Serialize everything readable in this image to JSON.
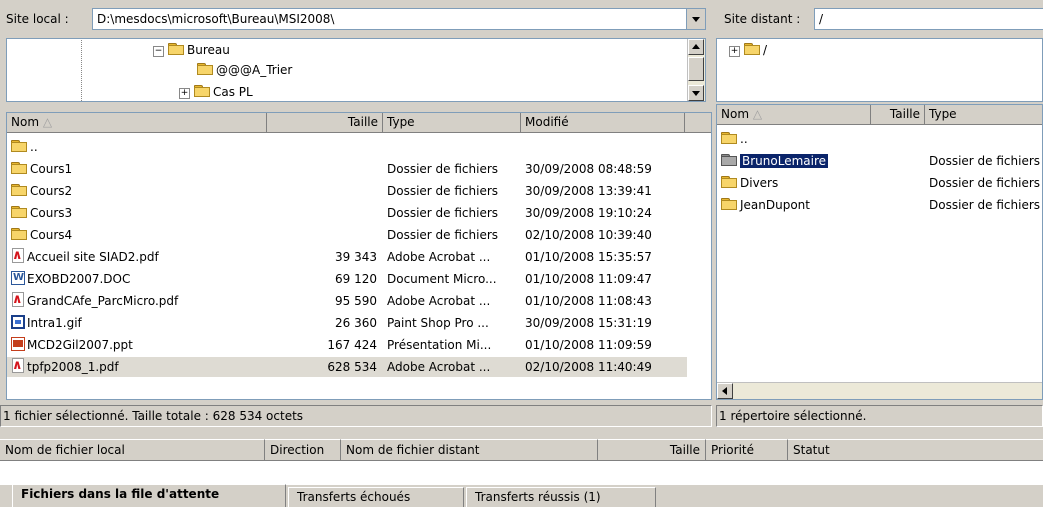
{
  "local": {
    "site_label": "Site local :",
    "path": "D:\\mesdocs\\microsoft\\Bureau\\MSI2008\\",
    "tree": [
      "Bureau",
      "@@@A_Trier",
      "Cas PL"
    ],
    "columns": {
      "name": "Nom",
      "size": "Taille",
      "type": "Type",
      "modified": "Modifié"
    },
    "files": [
      {
        "name": "..",
        "size": "",
        "type": "",
        "modified": "",
        "icon": "folder-icon"
      },
      {
        "name": "Cours1",
        "size": "",
        "type": "Dossier de fichiers",
        "modified": "30/09/2008 08:48:59",
        "icon": "folder-icon"
      },
      {
        "name": "Cours2",
        "size": "",
        "type": "Dossier de fichiers",
        "modified": "30/09/2008 13:39:41",
        "icon": "folder-icon"
      },
      {
        "name": "Cours3",
        "size": "",
        "type": "Dossier de fichiers",
        "modified": "30/09/2008 19:10:24",
        "icon": "folder-icon"
      },
      {
        "name": "Cours4",
        "size": "",
        "type": "Dossier de fichiers",
        "modified": "02/10/2008 10:39:40",
        "icon": "folder-icon"
      },
      {
        "name": "Accueil site SIAD2.pdf",
        "size": "39 343",
        "type": "Adobe Acrobat ...",
        "modified": "01/10/2008 15:35:57",
        "icon": "pdf-icon"
      },
      {
        "name": "EXOBD2007.DOC",
        "size": "69 120",
        "type": "Document Micro...",
        "modified": "01/10/2008 11:09:47",
        "icon": "word-doc-icon"
      },
      {
        "name": "GrandCAfe_ParcMicro.pdf",
        "size": "95 590",
        "type": "Adobe Acrobat ...",
        "modified": "01/10/2008 11:08:43",
        "icon": "pdf-icon"
      },
      {
        "name": "Intra1.gif",
        "size": "26 360",
        "type": "Paint Shop Pro ...",
        "modified": "30/09/2008 15:31:19",
        "icon": "gif-image-icon"
      },
      {
        "name": "MCD2Gil2007.ppt",
        "size": "167 424",
        "type": "Présentation Mi...",
        "modified": "01/10/2008 11:09:59",
        "icon": "powerpoint-icon"
      },
      {
        "name": "tpfp2008_1.pdf",
        "size": "628 534",
        "type": "Adobe Acrobat ...",
        "modified": "02/10/2008 11:40:49",
        "icon": "pdf-icon"
      }
    ],
    "status": "1 fichier sélectionné. Taille totale : 628 534 octets"
  },
  "remote": {
    "site_label": "Site distant :",
    "path": "/",
    "tree": [
      "/"
    ],
    "columns": {
      "name": "Nom",
      "size": "Taille",
      "type": "Type"
    },
    "files": [
      {
        "name": "..",
        "type": ""
      },
      {
        "name": "BrunoLemaire",
        "type": "Dossier de fichiers"
      },
      {
        "name": "Divers",
        "type": "Dossier de fichiers"
      },
      {
        "name": "JeanDupont",
        "type": "Dossier de fichiers"
      }
    ],
    "status": "1 répertoire sélectionné."
  },
  "queue": {
    "columns": {
      "local": "Nom de fichier local",
      "direction": "Direction",
      "remote": "Nom de fichier distant",
      "size": "Taille",
      "priority": "Priorité",
      "status": "Statut"
    },
    "tabs": [
      "Fichiers dans la file d'attente",
      "Transferts échoués",
      "Transferts réussis (1)"
    ]
  },
  "colors": {
    "selection": "#0a246a",
    "window": "#d4d0c8",
    "sort_arrow": "#a0a0a0"
  }
}
